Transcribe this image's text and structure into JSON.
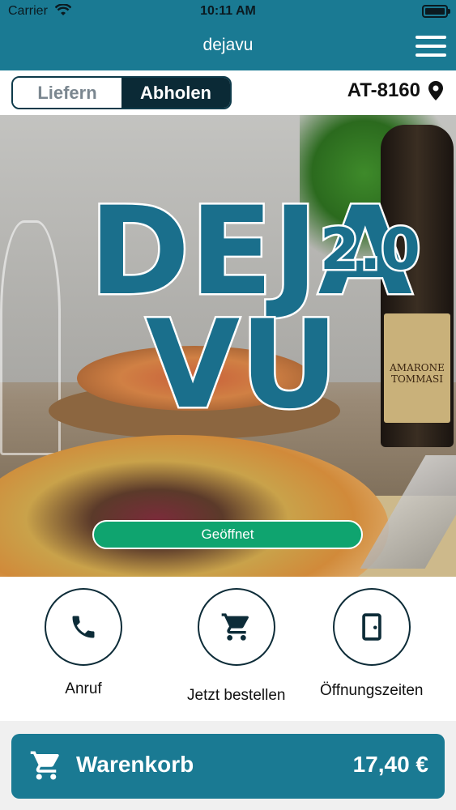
{
  "status_bar": {
    "carrier": "Carrier",
    "time": "10:11 AM"
  },
  "header": {
    "title": "dejavu"
  },
  "mode": {
    "delivery_label": "Liefern",
    "pickup_label": "Abholen",
    "selected": "pickup"
  },
  "location": {
    "postal_code": "AT-8160"
  },
  "hero": {
    "logo_text_1": "DEJA",
    "logo_text_2": "VU",
    "logo_version": "2.0",
    "bottle_label": "AMARONE TOMMASI",
    "status_label": "Geöffnet"
  },
  "actions": [
    {
      "label": "Anruf",
      "icon": "phone-icon"
    },
    {
      "label": "Jetzt bestellen",
      "icon": "shopping-cart-icon"
    },
    {
      "label": "Öffnungszeiten",
      "icon": "door-icon"
    }
  ],
  "cart": {
    "label": "Warenkorb",
    "total": "17,40 €",
    "icon": "shopping-cart-icon"
  },
  "colors": {
    "primary": "#1a7a93",
    "dark": "#0b2a36",
    "open_green": "#0fa46f",
    "logo_blue": "#1a6f8c"
  }
}
